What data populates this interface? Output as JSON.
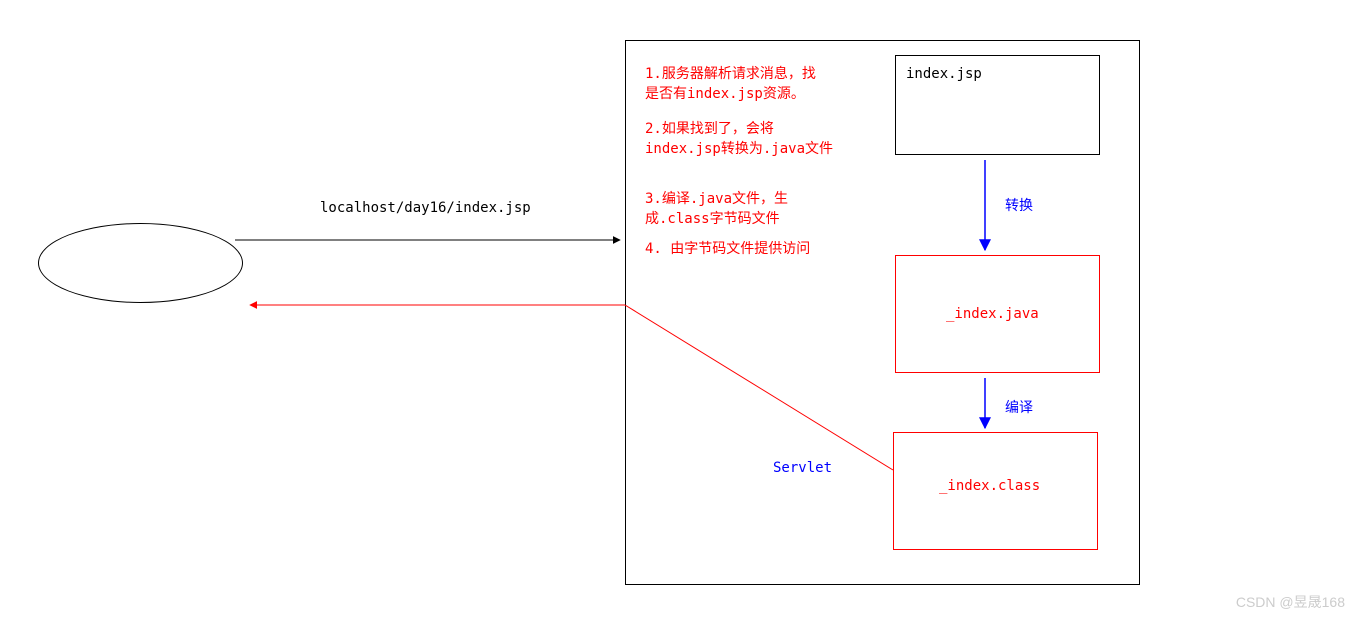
{
  "request_url": "localhost/day16/index.jsp",
  "steps": {
    "s1": "1.服务器解析请求消息，找\n是否有index.jsp资源。",
    "s2": "2.如果找到了，会将\nindex.jsp转换为.java文件",
    "s3": "3.编译.java文件，生\n成.class字节码文件",
    "s4": "4. 由字节码文件提供访问"
  },
  "files": {
    "jsp": "index.jsp",
    "java": "_index.java",
    "classfile": "_index.class"
  },
  "arrows": {
    "convert": "转换",
    "compile": "编译"
  },
  "servlet_label": "Servlet",
  "watermark": "CSDN @昱晟168"
}
